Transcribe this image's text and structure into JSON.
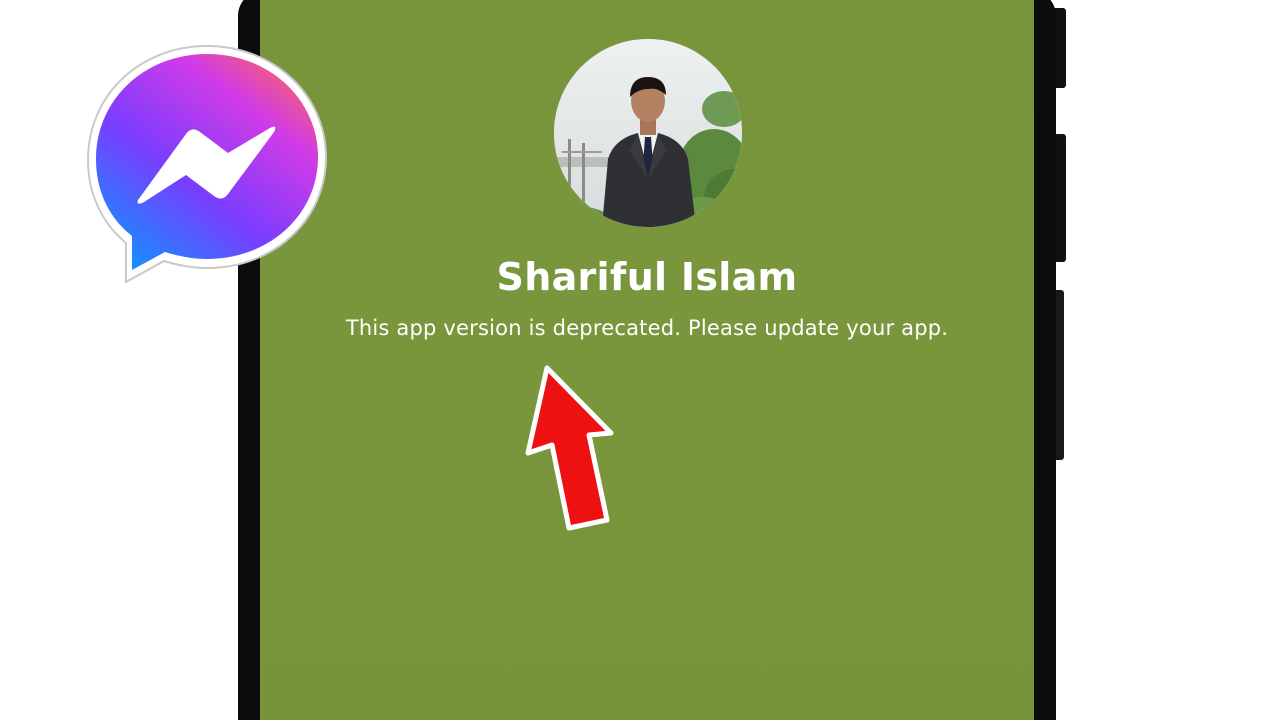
{
  "profile": {
    "name": "Shariful Islam",
    "message": "This app version is deprecated. Please update your app."
  },
  "icons": {
    "logo": "messenger-logo-icon",
    "avatar": "profile-photo",
    "pointer": "red-arrow-icon"
  },
  "colors": {
    "screen_background": "#7a963d",
    "text": "#ffffff",
    "arrow": "#ee1111",
    "phone_frame": "#0b0b0b"
  }
}
